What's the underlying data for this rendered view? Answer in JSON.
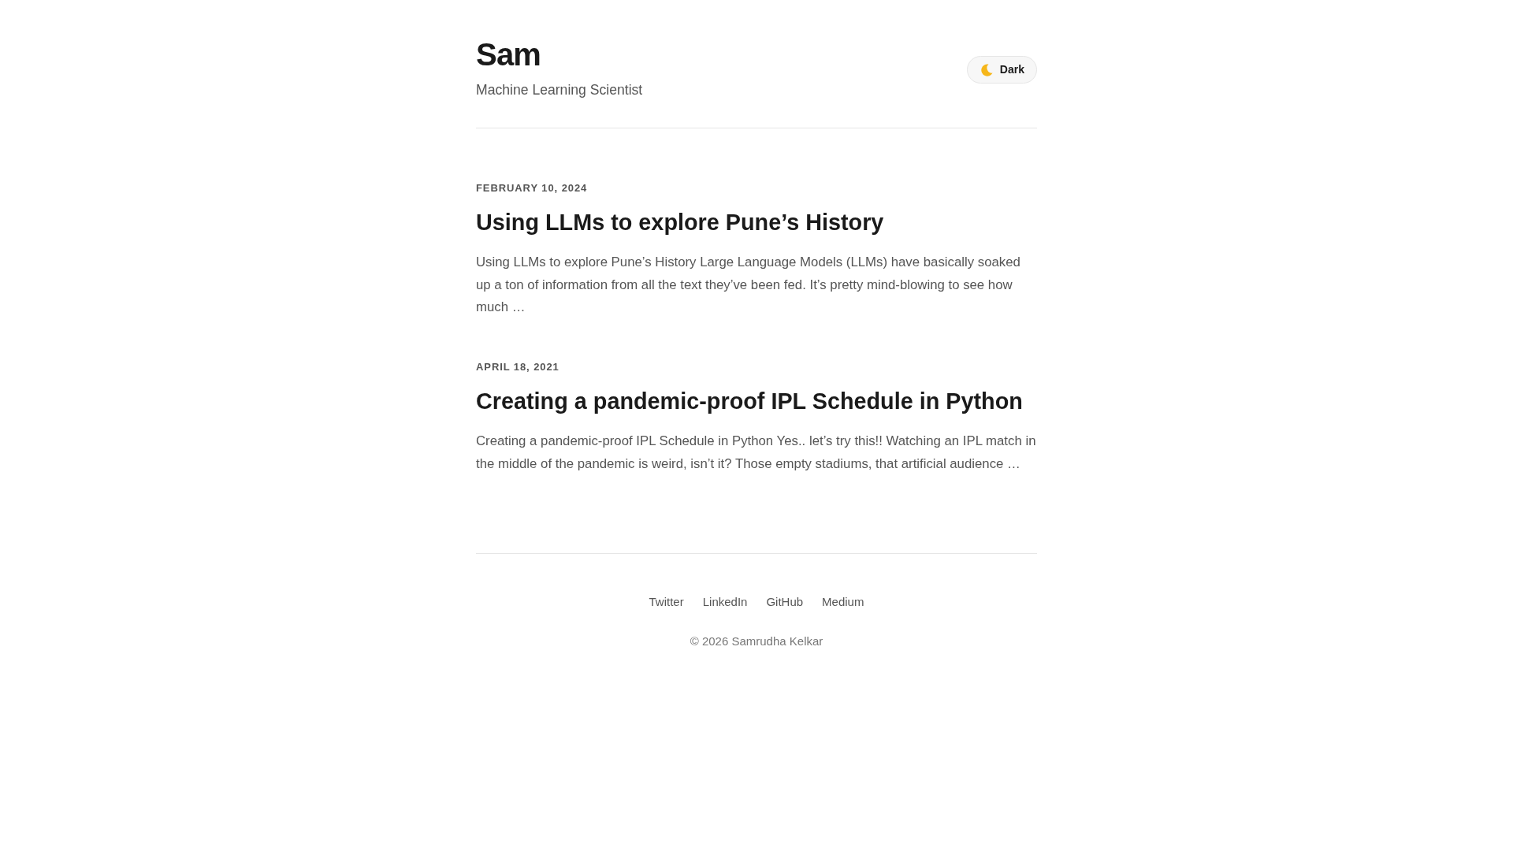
{
  "header": {
    "title": "Sam",
    "subtitle": "Machine Learning Scientist",
    "theme_button": {
      "label": "Dark"
    }
  },
  "posts": [
    {
      "date": "FEBRUARY 10, 2024",
      "title": "Using LLMs to explore Pune’s History",
      "excerpt": "Using LLMs to explore Pune’s History Large Language Models (LLMs) have basically soaked up a ton of information from all the text they’ve been fed. It’s pretty mind-blowing to see how much …"
    },
    {
      "date": "APRIL 18, 2021",
      "title": "Creating a pandemic-proof IPL Schedule in Python",
      "excerpt": "Creating a pandemic-proof IPL Schedule in Python Yes.. let’s try this!! Watching an IPL match in the middle of the pandemic is weird, isn’t it? Those empty stadiums, that artificial audience …"
    }
  ],
  "footer": {
    "links": [
      "Twitter",
      "LinkedIn",
      "GitHub",
      "Medium"
    ],
    "copyright": "© 2026 Samrudha Kelkar"
  }
}
